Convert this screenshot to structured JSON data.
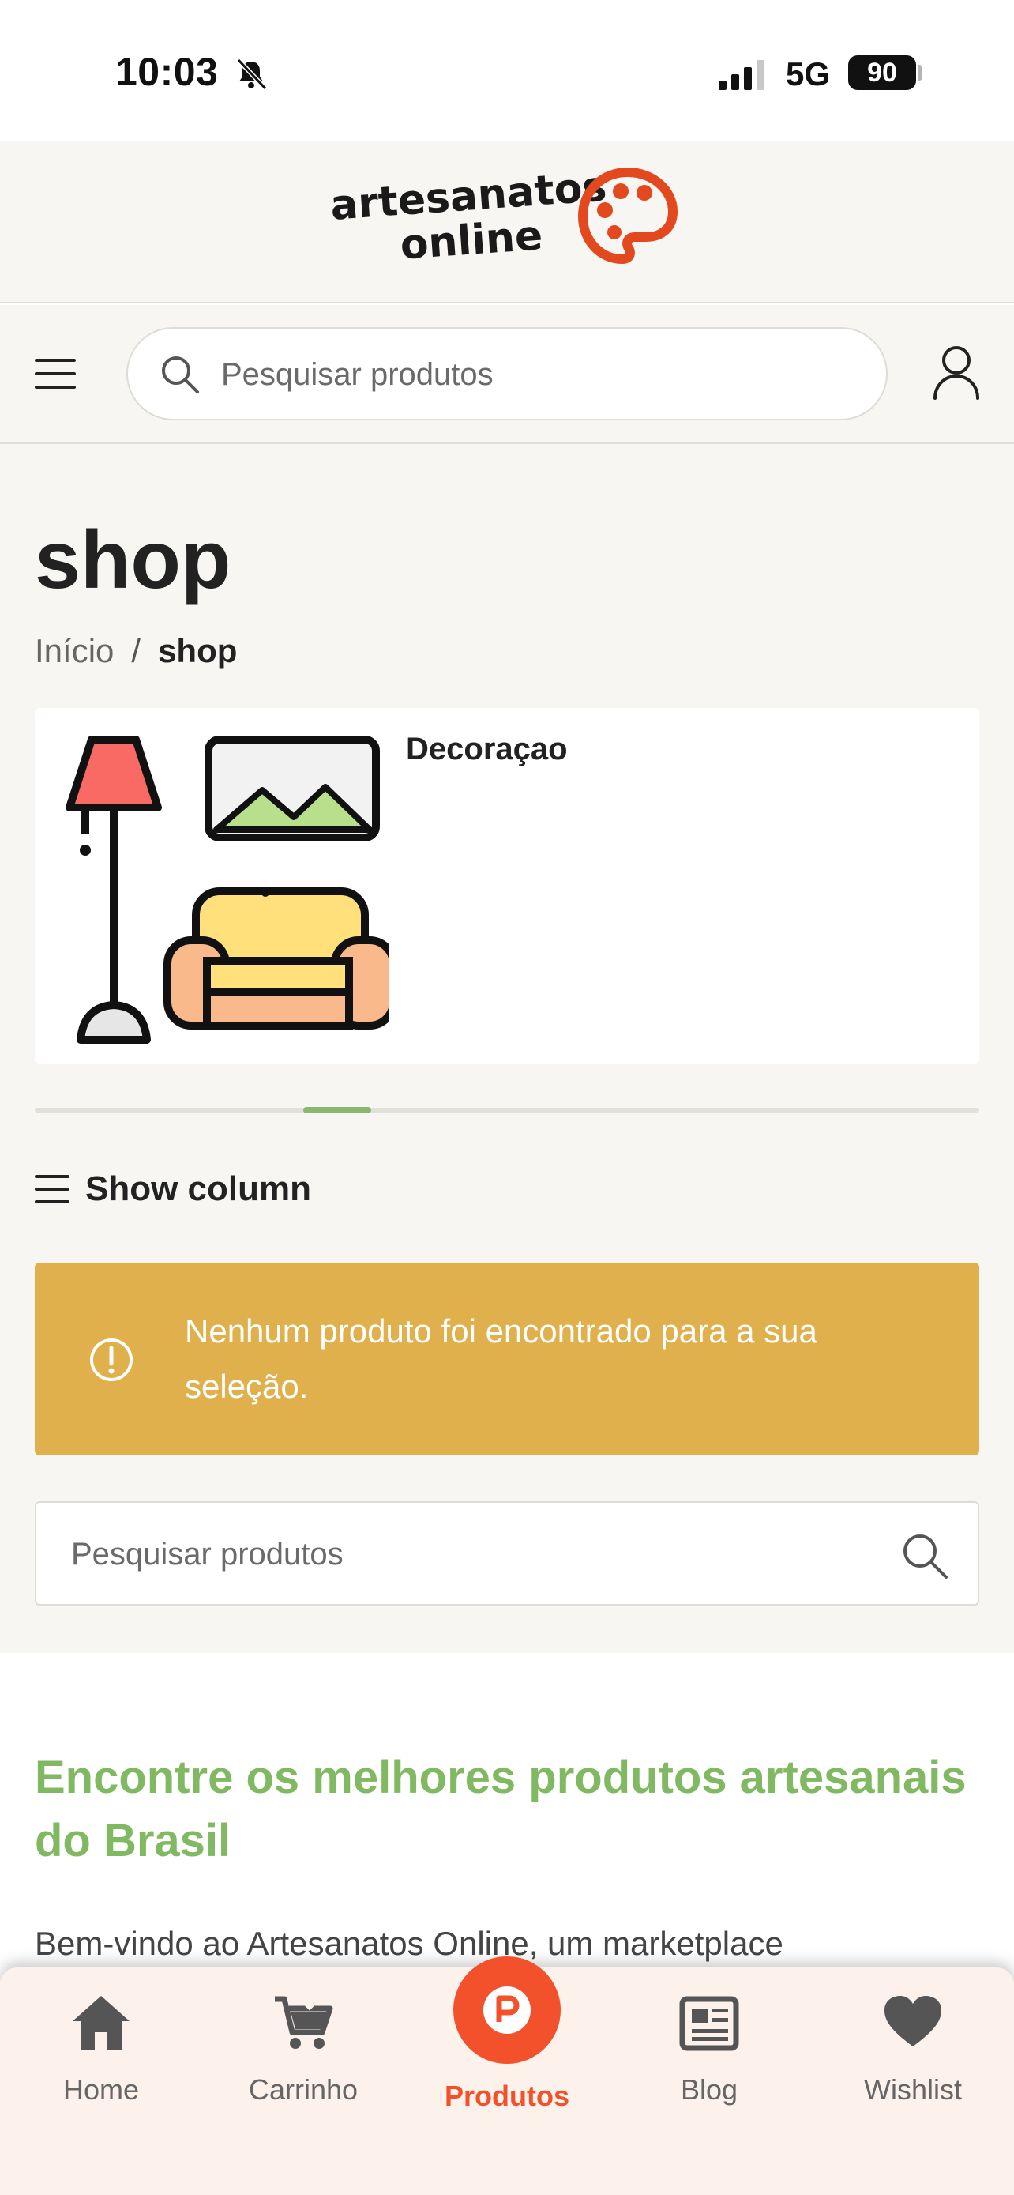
{
  "status_bar": {
    "time": "10:03",
    "network": "5G",
    "battery": "90"
  },
  "logo": {
    "line1": "artesanatos",
    "line2": "online"
  },
  "header": {
    "search_placeholder": "Pesquisar produtos"
  },
  "page": {
    "title": "shop",
    "breadcrumb": {
      "home": "Início",
      "separator": "/",
      "current": "shop"
    }
  },
  "categories": [
    {
      "name": "Decoraçao"
    }
  ],
  "filters": {
    "show_column_label": "Show column"
  },
  "notice": {
    "message": "Nenhum produto foi encontrado para a sua seleção."
  },
  "product_search": {
    "placeholder": "Pesquisar produtos"
  },
  "content": {
    "heading": "Encontre os melhores produtos artesanais do Brasil",
    "intro": "Bem-vindo ao Artesanatos Online, um marketplace"
  },
  "tab_bar": {
    "items": [
      {
        "label": "Home",
        "icon": "home-icon"
      },
      {
        "label": "Carrinho",
        "icon": "cart-icon"
      },
      {
        "label": "Produtos",
        "icon": "products-icon",
        "active": true
      },
      {
        "label": "Blog",
        "icon": "newspaper-icon"
      },
      {
        "label": "Wishlist",
        "icon": "heart-icon"
      }
    ]
  },
  "colors": {
    "accent_green": "#80b961",
    "notice_bg": "#e0b04d",
    "active_tab": "#f2512b",
    "logo_palette": "#e2491f"
  }
}
